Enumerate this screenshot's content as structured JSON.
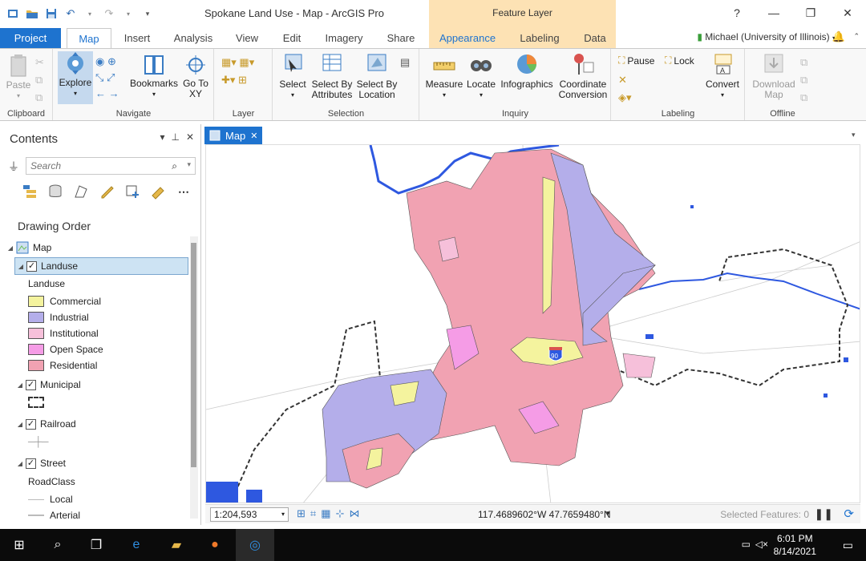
{
  "window": {
    "title": "Spokane Land Use - Map - ArcGIS Pro",
    "context_tab": "Feature Layer",
    "help": "?"
  },
  "tabs": [
    {
      "label": "Project"
    },
    {
      "label": "Map"
    },
    {
      "label": "Insert"
    },
    {
      "label": "Analysis"
    },
    {
      "label": "View"
    },
    {
      "label": "Edit"
    },
    {
      "label": "Imagery"
    },
    {
      "label": "Share"
    },
    {
      "label": "Appearance"
    },
    {
      "label": "Labeling"
    },
    {
      "label": "Data"
    }
  ],
  "user": "Michael (University of Illinois)",
  "ribbon": {
    "clipboard": {
      "label": "Clipboard",
      "paste": "Paste"
    },
    "navigate": {
      "label": "Navigate",
      "explore": "Explore",
      "bookmarks": "Bookmarks",
      "goto": "Go To XY"
    },
    "layer": {
      "label": "Layer"
    },
    "selection": {
      "label": "Selection",
      "select": "Select",
      "by_attr": "Select By Attributes",
      "by_loc": "Select By Location"
    },
    "inquiry": {
      "label": "Inquiry",
      "measure": "Measure",
      "locate": "Locate",
      "infographics": "Infographics",
      "coord": "Coordinate Conversion"
    },
    "labeling": {
      "label": "Labeling",
      "pause": "Pause",
      "lock": "Lock",
      "convert": "Convert"
    },
    "offline": {
      "label": "Offline",
      "download": "Download Map"
    }
  },
  "contents": {
    "title": "Contents",
    "search_placeholder": "Search",
    "drawing_order": "Drawing Order",
    "map": "Map",
    "layers": {
      "landuse": "Landuse",
      "landuse_field": "Landuse",
      "classes": [
        {
          "label": "Commercial",
          "color": "#f4f39e"
        },
        {
          "label": "Industrial",
          "color": "#b4aeea"
        },
        {
          "label": "Institutional",
          "color": "#f6c0da"
        },
        {
          "label": "Open Space",
          "color": "#f59ce6"
        },
        {
          "label": "Residential",
          "color": "#f1a2b2"
        }
      ],
      "municipal": "Municipal",
      "railroad": "Railroad",
      "street": "Street",
      "roadclass": "RoadClass",
      "local": "Local",
      "arterial": "Arterial"
    }
  },
  "map_tab": "Map",
  "map": {
    "shield": "90"
  },
  "status": {
    "scale": "1:204,593",
    "coords": "117.4689602°W 47.7659480°N",
    "selected": "Selected Features: 0"
  },
  "taskbar": {
    "time": "6:01 PM",
    "date": "8/14/2021"
  }
}
